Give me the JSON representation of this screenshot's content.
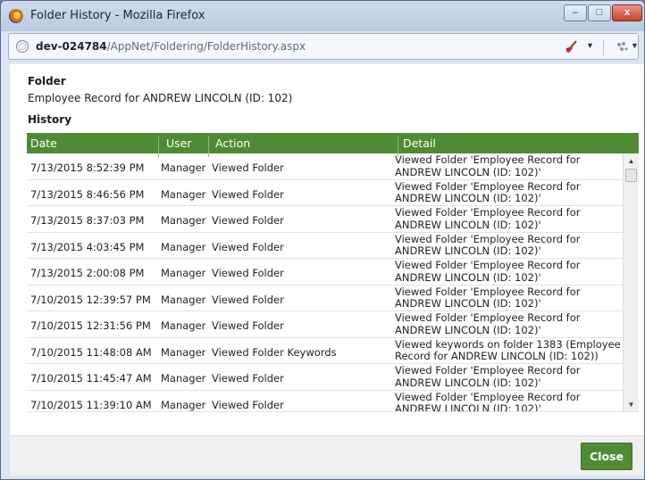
{
  "window": {
    "title": "Folder History - Mozilla Firefox",
    "controls": {
      "minimize": "–",
      "maximize": "□",
      "close": "x"
    }
  },
  "address_bar": {
    "host": "dev-024784",
    "path": "/AppNet/Foldering/FolderHistory.aspx",
    "icons": [
      "globe-icon",
      "broom-icon",
      "extension-icon"
    ]
  },
  "folder": {
    "label": "Folder",
    "value": "Employee Record for ANDREW LINCOLN (ID: 102)"
  },
  "history": {
    "label": "History",
    "columns": [
      "Date",
      "User",
      "Action",
      "Detail"
    ],
    "rows": [
      {
        "date": "7/13/2015 8:52:39 PM",
        "user": "Manager",
        "action": "Viewed Folder",
        "detail": "Viewed Folder 'Employee Record for ANDREW LINCOLN (ID: 102)'"
      },
      {
        "date": "7/13/2015 8:46:56 PM",
        "user": "Manager",
        "action": "Viewed Folder",
        "detail": "Viewed Folder 'Employee Record for ANDREW LINCOLN (ID: 102)'"
      },
      {
        "date": "7/13/2015 8:37:03 PM",
        "user": "Manager",
        "action": "Viewed Folder",
        "detail": "Viewed Folder 'Employee Record for ANDREW LINCOLN (ID: 102)'"
      },
      {
        "date": "7/13/2015 4:03:45 PM",
        "user": "Manager",
        "action": "Viewed Folder",
        "detail": "Viewed Folder 'Employee Record for ANDREW LINCOLN (ID: 102)'"
      },
      {
        "date": "7/13/2015 2:00:08 PM",
        "user": "Manager",
        "action": "Viewed Folder",
        "detail": "Viewed Folder 'Employee Record for ANDREW LINCOLN (ID: 102)'"
      },
      {
        "date": "7/10/2015 12:39:57 PM",
        "user": "Manager",
        "action": "Viewed Folder",
        "detail": "Viewed Folder 'Employee Record for ANDREW LINCOLN (ID: 102)'"
      },
      {
        "date": "7/10/2015 12:31:56 PM",
        "user": "Manager",
        "action": "Viewed Folder",
        "detail": "Viewed Folder 'Employee Record for ANDREW LINCOLN (ID: 102)'"
      },
      {
        "date": "7/10/2015 11:48:08 AM",
        "user": "Manager",
        "action": "Viewed Folder Keywords",
        "detail": "Viewed keywords on folder 1383 (Employee Record for ANDREW LINCOLN (ID: 102))"
      },
      {
        "date": "7/10/2015 11:45:47 AM",
        "user": "Manager",
        "action": "Viewed Folder",
        "detail": "Viewed Folder 'Employee Record for ANDREW LINCOLN (ID: 102)'"
      },
      {
        "date": "7/10/2015 11:39:10 AM",
        "user": "Manager",
        "action": "Viewed Folder",
        "detail": "Viewed Folder 'Employee Record for ANDREW LINCOLN (ID: 102)'"
      }
    ]
  },
  "footer": {
    "close_label": "Close"
  },
  "colors": {
    "accent": "#4f8a35",
    "header_text": "#ffffff"
  }
}
